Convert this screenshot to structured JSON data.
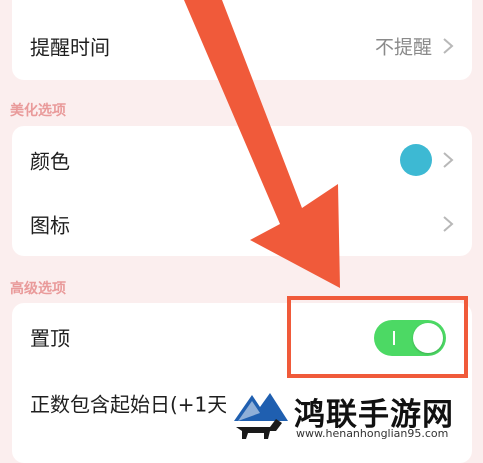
{
  "reminder": {
    "label": "提醒时间",
    "value": "不提醒"
  },
  "beautify": {
    "header": "美化选项",
    "color_label": "颜色",
    "color_value": "#3db9d3",
    "icon_label": "图标"
  },
  "advanced": {
    "header": "高级选项",
    "pin_label": "置顶",
    "pin_enabled": true,
    "count_start_label": "正数包含起始日(+1天)"
  },
  "toggle_color": "#4cd964",
  "annotation_color": "#f05a3a",
  "watermark": {
    "title": "鸿联手游网",
    "url": "www.henanhonglian95.com"
  }
}
